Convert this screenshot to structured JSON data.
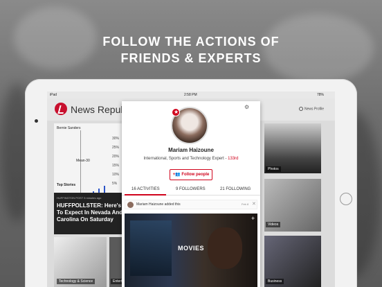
{
  "headline": {
    "line1": "FOLLOW THE ACTIONS OF",
    "line2": "FRIENDS & EXPERTS"
  },
  "status_bar": {
    "device": "iPad",
    "time": "2:58 PM",
    "battery": "78%"
  },
  "app": {
    "name": "News Republic",
    "profile_link": "News Profile"
  },
  "chart_card": {
    "title": "Bernie Sanders",
    "series_label": "Mean-30",
    "axis_ticks": [
      "30%",
      "25%",
      "20%",
      "15%",
      "10%",
      "5%"
    ],
    "section": "Top Stories"
  },
  "story": {
    "meta": "HUFFINGTON POST  5 minutes ago",
    "headline": "HUFFPOLLSTER: Here's What To Expect In Nevada And South Carolina On Saturday"
  },
  "tiles": [
    {
      "label": "Photos"
    },
    {
      "label": "Videos"
    },
    {
      "label": "Technology & Science"
    },
    {
      "label": "Entertainment"
    },
    {
      "label": "Business"
    }
  ],
  "profile": {
    "name": "Mariam Haizoune",
    "bio": "International, Sports and Technology Expert",
    "rank": "133rd",
    "rank_prefix": " - ",
    "follow_button": "Follow people"
  },
  "tabs": [
    {
      "label": "16 ACTIVITIES",
      "active": true
    },
    {
      "label": "9 FOLLOWERS",
      "active": false
    },
    {
      "label": "21 FOLLOWING",
      "active": false
    }
  ],
  "activity": {
    "text": "Mariam Haizoune added this",
    "date": "Feb 8"
  },
  "feature": {
    "label": "MOVIES"
  },
  "colors": {
    "accent": "#d0021b"
  }
}
